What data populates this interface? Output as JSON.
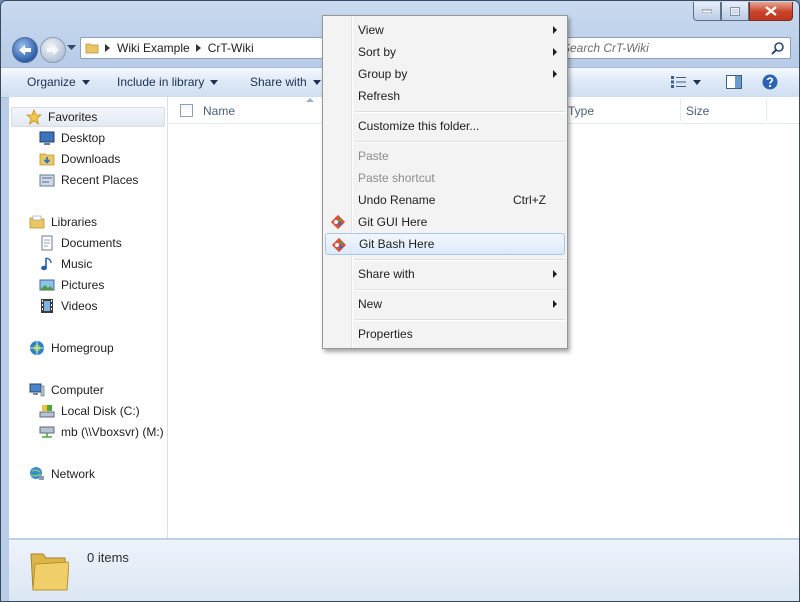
{
  "window": {
    "breadcrumb": [
      "Wiki Example",
      "CrT-Wiki"
    ],
    "search_placeholder": "Search CrT-Wiki"
  },
  "commandbar": {
    "organize": "Organize",
    "include_in_library": "Include in library",
    "share_with": "Share with"
  },
  "navigation": {
    "favorites": {
      "label": "Favorites",
      "items": [
        "Desktop",
        "Downloads",
        "Recent Places"
      ]
    },
    "libraries": {
      "label": "Libraries",
      "items": [
        "Documents",
        "Music",
        "Pictures",
        "Videos"
      ]
    },
    "homegroup": "Homegroup",
    "computer": {
      "label": "Computer",
      "items": [
        "Local Disk (C:)",
        "mb (\\\\Vboxsvr) (M:)"
      ]
    },
    "network": "Network"
  },
  "filelist": {
    "columns": [
      "Name",
      "Type",
      "Size"
    ]
  },
  "details": {
    "count": "0 items"
  },
  "context_menu": {
    "view": "View",
    "sort_by": "Sort by",
    "group_by": "Group by",
    "refresh": "Refresh",
    "customize": "Customize this folder...",
    "paste": "Paste",
    "paste_shortcut": "Paste shortcut",
    "undo_rename": "Undo Rename",
    "undo_shortcut": "Ctrl+Z",
    "git_gui": "Git GUI Here",
    "git_bash": "Git Bash Here",
    "share_with": "Share with",
    "new": "New",
    "properties": "Properties"
  },
  "icons": {
    "back": "back-arrow-icon",
    "forward": "forward-arrow-icon",
    "folder": "folder-icon",
    "search": "search-icon",
    "git": "git-icon",
    "star": "star-icon"
  },
  "colors": {
    "accent": "#2b5ea8",
    "menu_hover_border": "#a8c6ea",
    "close_button": "#c7432a"
  }
}
